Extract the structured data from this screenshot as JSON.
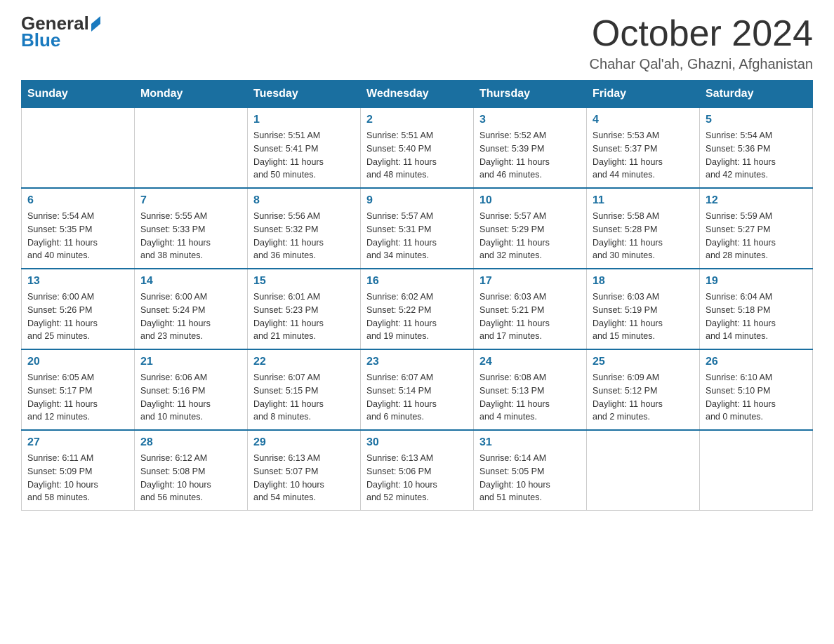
{
  "header": {
    "logo_general": "General",
    "logo_blue": "Blue",
    "month_title": "October 2024",
    "location": "Chahar Qal'ah, Ghazni, Afghanistan"
  },
  "weekdays": [
    "Sunday",
    "Monday",
    "Tuesday",
    "Wednesday",
    "Thursday",
    "Friday",
    "Saturday"
  ],
  "weeks": [
    [
      {
        "day": "",
        "info": ""
      },
      {
        "day": "",
        "info": ""
      },
      {
        "day": "1",
        "info": "Sunrise: 5:51 AM\nSunset: 5:41 PM\nDaylight: 11 hours\nand 50 minutes."
      },
      {
        "day": "2",
        "info": "Sunrise: 5:51 AM\nSunset: 5:40 PM\nDaylight: 11 hours\nand 48 minutes."
      },
      {
        "day": "3",
        "info": "Sunrise: 5:52 AM\nSunset: 5:39 PM\nDaylight: 11 hours\nand 46 minutes."
      },
      {
        "day": "4",
        "info": "Sunrise: 5:53 AM\nSunset: 5:37 PM\nDaylight: 11 hours\nand 44 minutes."
      },
      {
        "day": "5",
        "info": "Sunrise: 5:54 AM\nSunset: 5:36 PM\nDaylight: 11 hours\nand 42 minutes."
      }
    ],
    [
      {
        "day": "6",
        "info": "Sunrise: 5:54 AM\nSunset: 5:35 PM\nDaylight: 11 hours\nand 40 minutes."
      },
      {
        "day": "7",
        "info": "Sunrise: 5:55 AM\nSunset: 5:33 PM\nDaylight: 11 hours\nand 38 minutes."
      },
      {
        "day": "8",
        "info": "Sunrise: 5:56 AM\nSunset: 5:32 PM\nDaylight: 11 hours\nand 36 minutes."
      },
      {
        "day": "9",
        "info": "Sunrise: 5:57 AM\nSunset: 5:31 PM\nDaylight: 11 hours\nand 34 minutes."
      },
      {
        "day": "10",
        "info": "Sunrise: 5:57 AM\nSunset: 5:29 PM\nDaylight: 11 hours\nand 32 minutes."
      },
      {
        "day": "11",
        "info": "Sunrise: 5:58 AM\nSunset: 5:28 PM\nDaylight: 11 hours\nand 30 minutes."
      },
      {
        "day": "12",
        "info": "Sunrise: 5:59 AM\nSunset: 5:27 PM\nDaylight: 11 hours\nand 28 minutes."
      }
    ],
    [
      {
        "day": "13",
        "info": "Sunrise: 6:00 AM\nSunset: 5:26 PM\nDaylight: 11 hours\nand 25 minutes."
      },
      {
        "day": "14",
        "info": "Sunrise: 6:00 AM\nSunset: 5:24 PM\nDaylight: 11 hours\nand 23 minutes."
      },
      {
        "day": "15",
        "info": "Sunrise: 6:01 AM\nSunset: 5:23 PM\nDaylight: 11 hours\nand 21 minutes."
      },
      {
        "day": "16",
        "info": "Sunrise: 6:02 AM\nSunset: 5:22 PM\nDaylight: 11 hours\nand 19 minutes."
      },
      {
        "day": "17",
        "info": "Sunrise: 6:03 AM\nSunset: 5:21 PM\nDaylight: 11 hours\nand 17 minutes."
      },
      {
        "day": "18",
        "info": "Sunrise: 6:03 AM\nSunset: 5:19 PM\nDaylight: 11 hours\nand 15 minutes."
      },
      {
        "day": "19",
        "info": "Sunrise: 6:04 AM\nSunset: 5:18 PM\nDaylight: 11 hours\nand 14 minutes."
      }
    ],
    [
      {
        "day": "20",
        "info": "Sunrise: 6:05 AM\nSunset: 5:17 PM\nDaylight: 11 hours\nand 12 minutes."
      },
      {
        "day": "21",
        "info": "Sunrise: 6:06 AM\nSunset: 5:16 PM\nDaylight: 11 hours\nand 10 minutes."
      },
      {
        "day": "22",
        "info": "Sunrise: 6:07 AM\nSunset: 5:15 PM\nDaylight: 11 hours\nand 8 minutes."
      },
      {
        "day": "23",
        "info": "Sunrise: 6:07 AM\nSunset: 5:14 PM\nDaylight: 11 hours\nand 6 minutes."
      },
      {
        "day": "24",
        "info": "Sunrise: 6:08 AM\nSunset: 5:13 PM\nDaylight: 11 hours\nand 4 minutes."
      },
      {
        "day": "25",
        "info": "Sunrise: 6:09 AM\nSunset: 5:12 PM\nDaylight: 11 hours\nand 2 minutes."
      },
      {
        "day": "26",
        "info": "Sunrise: 6:10 AM\nSunset: 5:10 PM\nDaylight: 11 hours\nand 0 minutes."
      }
    ],
    [
      {
        "day": "27",
        "info": "Sunrise: 6:11 AM\nSunset: 5:09 PM\nDaylight: 10 hours\nand 58 minutes."
      },
      {
        "day": "28",
        "info": "Sunrise: 6:12 AM\nSunset: 5:08 PM\nDaylight: 10 hours\nand 56 minutes."
      },
      {
        "day": "29",
        "info": "Sunrise: 6:13 AM\nSunset: 5:07 PM\nDaylight: 10 hours\nand 54 minutes."
      },
      {
        "day": "30",
        "info": "Sunrise: 6:13 AM\nSunset: 5:06 PM\nDaylight: 10 hours\nand 52 minutes."
      },
      {
        "day": "31",
        "info": "Sunrise: 6:14 AM\nSunset: 5:05 PM\nDaylight: 10 hours\nand 51 minutes."
      },
      {
        "day": "",
        "info": ""
      },
      {
        "day": "",
        "info": ""
      }
    ]
  ]
}
